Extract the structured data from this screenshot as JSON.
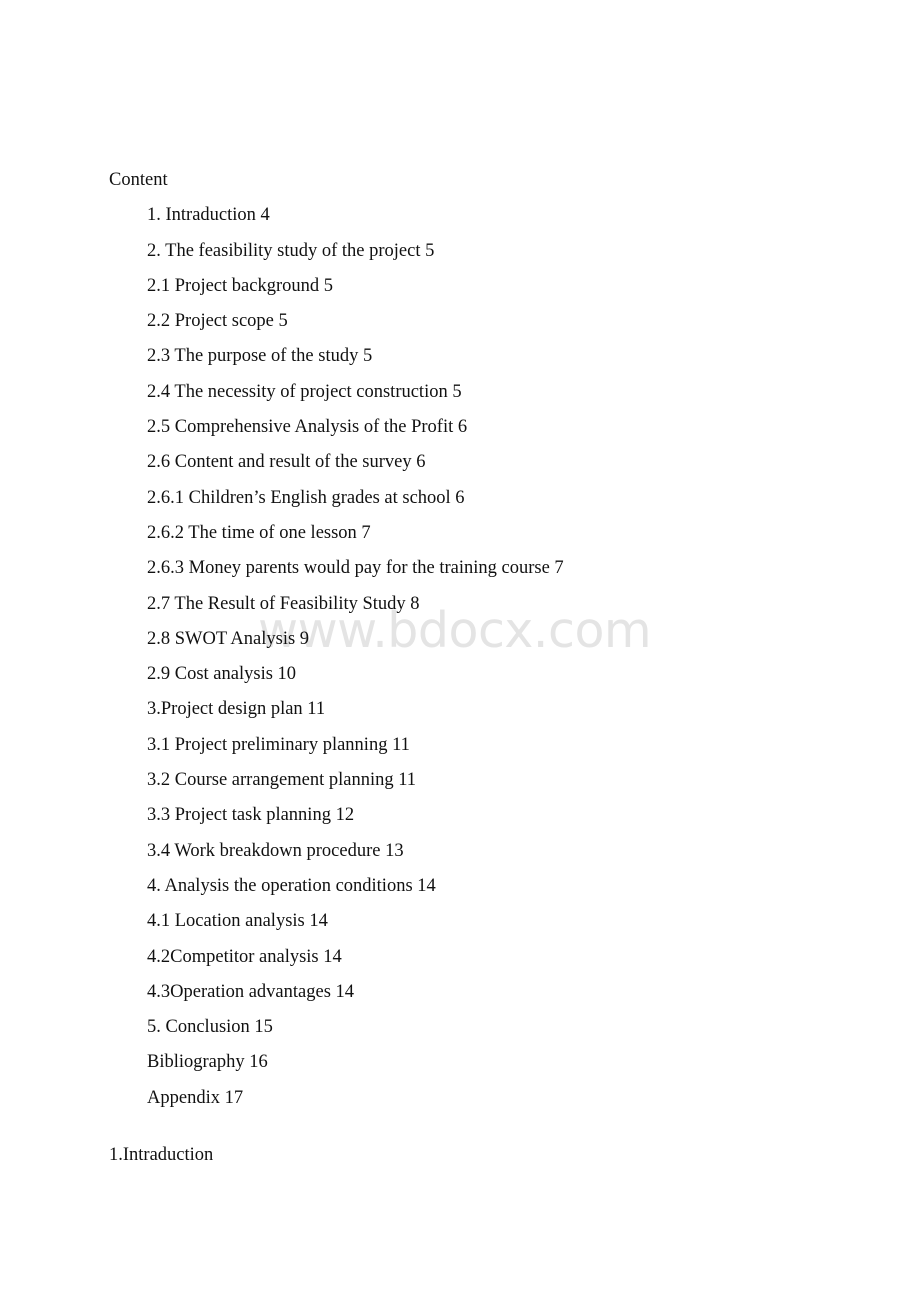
{
  "document": {
    "heading": "Content",
    "watermark": "www.bdocx.com",
    "toc_entries": [
      "1. Intraduction 4",
      "2. The feasibility study of the project 5",
      "2.1 Project background 5",
      "2.2 Project scope 5",
      "2.3 The purpose of the study 5",
      "2.4 The necessity of project construction 5",
      "2.5 Comprehensive Analysis of the Profit 6",
      "2.6 Content and result of the survey 6",
      "2.6.1 Children’s English grades at school 6",
      "2.6.2 The time of one lesson 7",
      "2.6.3 Money parents would pay for the training course 7",
      "2.7 The Result of Feasibility Study 8",
      "2.8 SWOT Analysis 9",
      "2.9 Cost analysis 10",
      "3.Project design plan 11",
      "3.1 Project preliminary planning 11",
      "3.2 Course arrangement planning 11",
      "3.3 Project task planning 12",
      "3.4 Work breakdown procedure 13",
      "4. Analysis the operation conditions 14",
      "4.1 Location analysis 14",
      "4.2Competitor analysis 14",
      "4.3Operation advantages 14",
      "5. Conclusion 15",
      "Bibliography 16",
      "Appendix 17"
    ],
    "closing_heading": "1.Intraduction"
  },
  "colors": {
    "page_background": "#ffffff",
    "text": "#111111",
    "watermark": "#e4e4e4"
  }
}
